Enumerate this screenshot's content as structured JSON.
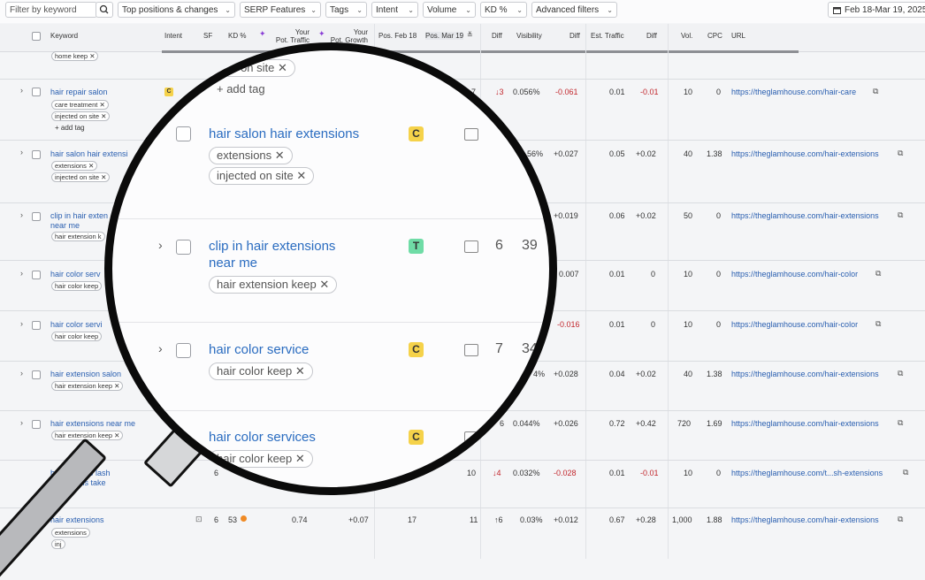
{
  "filters": {
    "keyword_placeholder": "Filter by keyword",
    "top_positions": "Top positions & changes",
    "serp_features": "SERP Features",
    "tags": "Tags",
    "intent": "Intent",
    "volume": "Volume",
    "kd": "KD %",
    "advanced": "Advanced filters",
    "date_range": "Feb 18-Mar 19, 2025"
  },
  "columns": {
    "keyword": "Keyword",
    "intent": "Intent",
    "sf": "SF",
    "kd": "KD %",
    "pot_traffic_1": "Your",
    "pot_traffic_2": "Pot. Traffic",
    "pot_growth_1": "Your",
    "pot_growth_2": "Pot. Growth",
    "pos_feb": "Pos. Feb 18",
    "pos_mar": "Pos. Mar 19",
    "diff": "Diff",
    "visibility": "Visibility",
    "diff2": "Diff",
    "est_traffic": "Est. Traffic",
    "diff3": "Diff",
    "vol": "Vol.",
    "cpc": "CPC",
    "url": "URL"
  },
  "top_partial_tag": "home keep",
  "rows": [
    {
      "keyword": "hair repair salon",
      "tags": [
        "care treatment",
        "injected on site"
      ],
      "add_tag": "+ add tag",
      "pos_mar": "7",
      "diff": "↓3",
      "visibility": "0.056%",
      "vis_diff": "-0.061",
      "traffic": "0.01",
      "traffic_diff": "-0.01",
      "vol": "10",
      "cpc": "0",
      "url": "https://theglamhouse.com/hair-care"
    },
    {
      "keyword": "hair salon hair extensi",
      "tags": [
        "extensions",
        "injected on site"
      ],
      "visibility": "56%",
      "vis_diff": "+0.027",
      "traffic": "0.05",
      "traffic_diff": "+0.02",
      "vol": "40",
      "cpc": "1.38",
      "url": "https://theglamhouse.com/hair-extensions"
    },
    {
      "keyword": "clip in hair exten",
      "keyword2": "near me",
      "tags": [
        "hair extension k"
      ],
      "vis_diff": "+0.019",
      "traffic": "0.06",
      "traffic_diff": "+0.02",
      "vol": "50",
      "cpc": "0",
      "url": "https://theglamhouse.com/hair-extensions"
    },
    {
      "keyword": "hair color serv",
      "tags": [
        "hair color keep"
      ],
      "vis_diff": "0.007",
      "traffic": "0.01",
      "traffic_diff": "0",
      "vol": "10",
      "cpc": "0",
      "url": "https://theglamhouse.com/hair-color"
    },
    {
      "keyword": "hair color servi",
      "tags": [
        "hair color keep"
      ],
      "vis_diff": "-0.016",
      "traffic": "0.01",
      "traffic_diff": "0",
      "vol": "10",
      "cpc": "0",
      "url": "https://theglamhouse.com/hair-color"
    },
    {
      "keyword": "hair extension salon",
      "tags": [
        "hair extension keep"
      ],
      "visibility": "4%",
      "vis_diff": "+0.028",
      "traffic": "0.04",
      "traffic_diff": "+0.02",
      "vol": "40",
      "cpc": "1.38",
      "url": "https://theglamhouse.com/hair-extensions"
    },
    {
      "keyword": "hair extensions near me",
      "tags": [
        "hair extension keep"
      ],
      "pos_mar": "6",
      "visibility": "0.044%",
      "vis_diff": "+0.026",
      "traffic": "0.72",
      "traffic_diff": "+0.42",
      "vol": "720",
      "cpc": "1.69",
      "url": "https://theglamhouse.com/hair-extensions"
    },
    {
      "keyword": "how long do lash",
      "keyword2": "extensions take",
      "sf": "6",
      "pos_mar": "10",
      "diff": "↓4",
      "visibility": "0.032%",
      "vis_diff": "-0.028",
      "traffic": "0.01",
      "traffic_diff": "-0.01",
      "vol": "10",
      "cpc": "0",
      "url": "https://theglamhouse.com/t...sh-extensions"
    },
    {
      "keyword": "hair extensions",
      "tags": [
        "extensions",
        "inj"
      ],
      "sf": "6",
      "kd": "53",
      "pot_traffic": "0.74",
      "pot_growth": "+0.07",
      "pos_feb": "17",
      "pos_mar": "11",
      "diff": "↑6",
      "visibility": "0.03%",
      "vis_diff": "+0.012",
      "traffic": "0.67",
      "traffic_diff": "+0.28",
      "vol": "1,000",
      "cpc": "1.88",
      "url": "https://theglamhouse.com/hair-extensions"
    }
  ],
  "lens": {
    "top_tag": "ed on site",
    "add_tag": "+ add tag",
    "rows": [
      {
        "keyword": "hair salon hair extensions",
        "intent": "C",
        "tags": [
          "extensions",
          "injected on site"
        ]
      },
      {
        "keyword": "clip in hair extensions",
        "keyword2": "near me",
        "intent": "T",
        "sf": "6",
        "kd": "39",
        "tags": [
          "hair extension keep"
        ]
      },
      {
        "keyword": "hair color service",
        "intent": "C",
        "sf": "7",
        "kd": "34",
        "tags": [
          "hair color keep"
        ]
      },
      {
        "keyword": "hair color services",
        "intent": "C",
        "tags": [
          "hair color keep"
        ]
      }
    ]
  },
  "colors": {
    "accent": "#2a5fb0",
    "negative": "#c2272d",
    "intent_c": "#f5d24a",
    "intent_t": "#5fd49a"
  }
}
